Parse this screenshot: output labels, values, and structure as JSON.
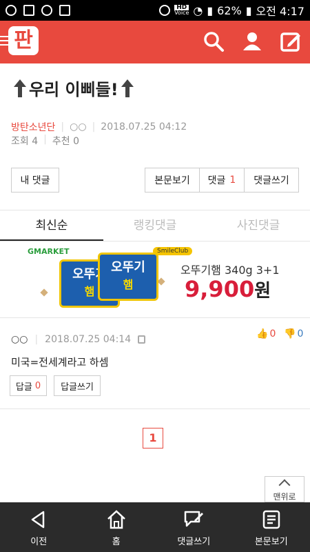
{
  "status_bar": {
    "battery": "62%",
    "time": "오전 4:17",
    "hd_label": "HD",
    "voice_label": "Voice"
  },
  "app": {
    "logo_text": "판"
  },
  "post": {
    "title": "우리 이삐들!",
    "author": "방탄소년단",
    "author_badge": "○○",
    "datetime": "2018.07.25 04:12",
    "views_label": "조회",
    "views": "4",
    "recommend_label": "추천",
    "recommend": "0"
  },
  "buttons": {
    "my_comments": "내 댓글",
    "view_post": "본문보기",
    "comments": "댓글",
    "comments_count": "1",
    "write_comment": "댓글쓰기"
  },
  "tabs": [
    "최신순",
    "랭킹댓글",
    "사진댓글"
  ],
  "ad": {
    "brand": "GMARKET",
    "badge": "SmileClub",
    "can_text": "오뚜기",
    "can_text2": "햄",
    "product": "오뚜기햄 340g 3+1",
    "price": "9,900",
    "currency": "원"
  },
  "comment": {
    "nickname": "○○",
    "datetime": "2018.07.25 04:14",
    "text": "미국=전세계라고 하셈",
    "up": "0",
    "down": "0",
    "reply_label": "답글",
    "reply_count": "0",
    "write_reply": "답글쓰기"
  },
  "pagination": {
    "current": "1"
  },
  "to_top": "맨위로",
  "bottom_nav": [
    "이전",
    "홈",
    "댓글쓰기",
    "본문보기"
  ],
  "colors": {
    "brand": "#e8493e",
    "price": "#d81e3a"
  }
}
